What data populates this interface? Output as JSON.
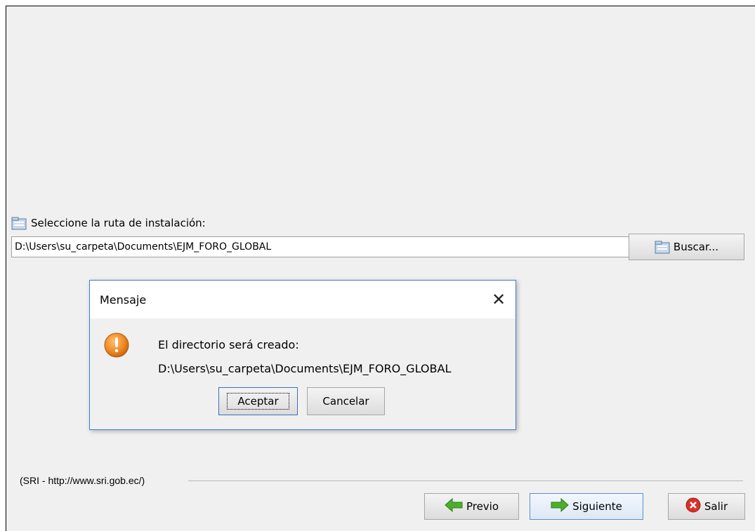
{
  "install": {
    "label": "Seleccione la ruta de instalación:",
    "path_value": "D:\\Users\\su_carpeta\\Documents\\EJM_FORO_GLOBAL",
    "browse_label": "Buscar..."
  },
  "footer": {
    "label": "(SRI - http://www.sri.gob.ec/)"
  },
  "nav": {
    "prev_label": "Previo",
    "next_label": "Siguiente",
    "exit_label": "Salir"
  },
  "dialog": {
    "title": "Mensaje",
    "close_glyph": "✕",
    "message_line1": "El directorio será creado:",
    "message_line2": "D:\\Users\\su_carpeta\\Documents\\EJM_FORO_GLOBAL",
    "ok_label": "Aceptar",
    "cancel_label": "Cancelar"
  },
  "colors": {
    "window_bg": "#f0f0f0",
    "dialog_border": "#3a7fd0",
    "warning_orange": "#f08a24",
    "arrow_green": "#4caf2a",
    "exit_red": "#d9302c"
  },
  "icons": [
    "folder-icon",
    "warning-icon",
    "arrow-left-icon",
    "arrow-right-icon",
    "close-circle-icon",
    "close-icon"
  ]
}
